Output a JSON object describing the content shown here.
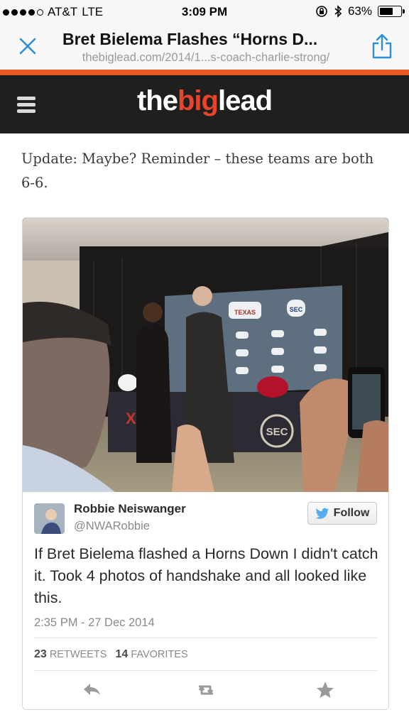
{
  "status_bar": {
    "carrier": "AT&T",
    "network": "LTE",
    "time": "3:09 PM",
    "battery": "63%",
    "battery_level": 0.63
  },
  "browser": {
    "page_title": "Bret Bielema Flashes “Horns D...",
    "url": "thebiglead.com/2014/1...s-coach-charlie-strong/"
  },
  "site": {
    "logo_the": "the",
    "logo_big": "big",
    "logo_lead": "lead",
    "accent_color": "#e8432b"
  },
  "article": {
    "text": "Update: Maybe? Reminder – these teams are both 6-6."
  },
  "tweet": {
    "author_name": "Robbie Neiswanger",
    "author_handle": "@NWARobbie",
    "follow_label": "Follow",
    "text": "If Bret Bielema flashed a Horns Down I didn't catch it. Took 4 photos of handshake and all looked like this.",
    "timestamp": "2:35 PM - 27 Dec 2014",
    "retweets_count": "23",
    "retweets_label": "RETWEETS",
    "favorites_count": "14",
    "favorites_label": "FAVORITES",
    "photo_banner_text": "TEXAS",
    "photo_sec_text": "SEC",
    "photo_xii_text": "XII"
  }
}
